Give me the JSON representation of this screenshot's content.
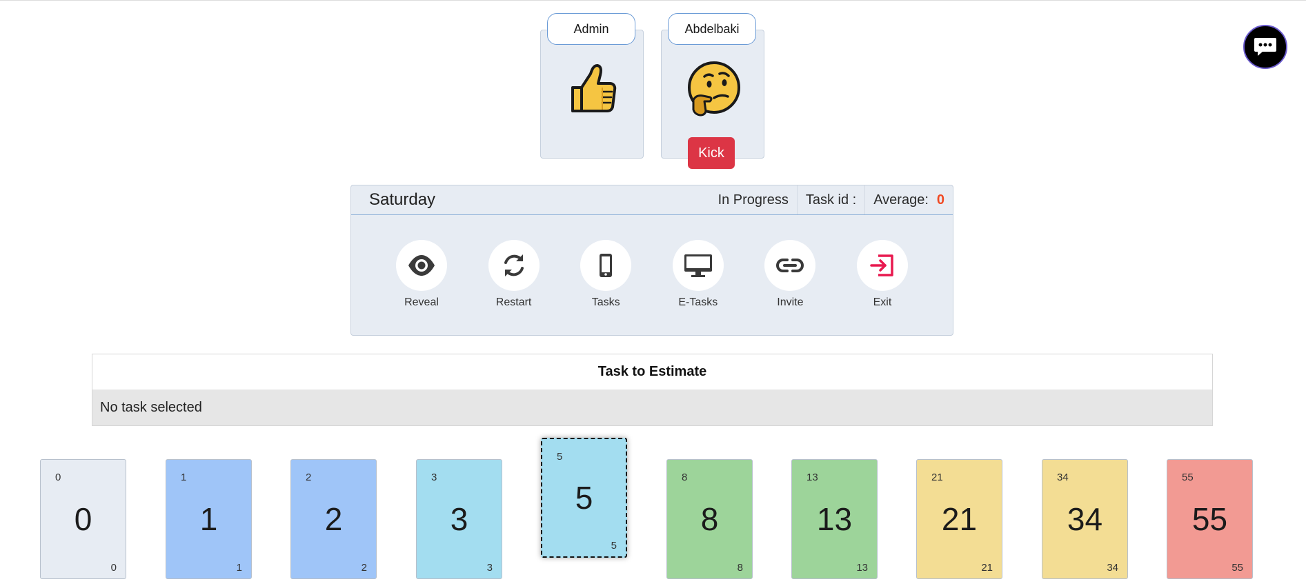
{
  "players": [
    {
      "name": "Admin",
      "vote_icon": "thumbs-up-icon"
    },
    {
      "name": "Abdelbaki",
      "vote_icon": "thinking-face-icon",
      "kick_label": "Kick"
    }
  ],
  "panel": {
    "title": "Saturday",
    "status": "In Progress",
    "task_id_label": "Task id :",
    "average_label": "Average:",
    "average_value": "0",
    "actions": [
      {
        "label": "Reveal",
        "icon": "eye-icon"
      },
      {
        "label": "Restart",
        "icon": "refresh-icon"
      },
      {
        "label": "Tasks",
        "icon": "mobile-icon"
      },
      {
        "label": "E-Tasks",
        "icon": "monitor-icon"
      },
      {
        "label": "Invite",
        "icon": "link-icon"
      },
      {
        "label": "Exit",
        "icon": "exit-icon"
      }
    ]
  },
  "task": {
    "header": "Task to Estimate",
    "body": "No task selected"
  },
  "cards": [
    {
      "value": "0",
      "color": "#e7ecf3"
    },
    {
      "value": "1",
      "color": "#9fc5f8"
    },
    {
      "value": "2",
      "color": "#9fc5f8"
    },
    {
      "value": "3",
      "color": "#a3ddf0"
    },
    {
      "value": "5",
      "color": "#a3ddf0",
      "selected": true
    },
    {
      "value": "8",
      "color": "#9dd49a"
    },
    {
      "value": "13",
      "color": "#9dd49a"
    },
    {
      "value": "21",
      "color": "#f3dd94"
    },
    {
      "value": "34",
      "color": "#f3dd94"
    },
    {
      "value": "55",
      "color": "#f29a93"
    }
  ],
  "accent_colors": {
    "kick": "#dc3545",
    "average": "#f04a23",
    "exit": "#e8194f"
  }
}
